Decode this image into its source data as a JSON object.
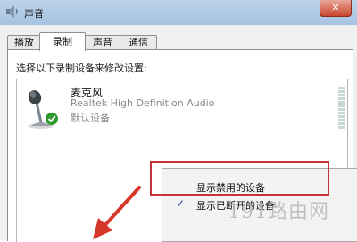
{
  "window": {
    "title": "声音",
    "close_label": "✕"
  },
  "tabs": [
    {
      "label": "播放",
      "active": false
    },
    {
      "label": "录制",
      "active": true
    },
    {
      "label": "声音",
      "active": false
    },
    {
      "label": "通信",
      "active": false
    }
  ],
  "panel": {
    "instruction": "选择以下录制设备来修改设置:"
  },
  "device": {
    "name": "麦克风",
    "description": "Realtek High Definition Audio",
    "status": "默认设备",
    "icon": "microphone-icon",
    "badge_icon": "default-check-icon",
    "badge_color": "#2e9a2e"
  },
  "context_menu": {
    "items": [
      {
        "label": "显示禁用的设备",
        "checked": false
      },
      {
        "label": "显示已断开的设备",
        "checked": true
      }
    ]
  },
  "annotations": {
    "highlight_color": "#c8323a",
    "arrow_color": "#d6372b"
  },
  "watermark": "191路由网"
}
